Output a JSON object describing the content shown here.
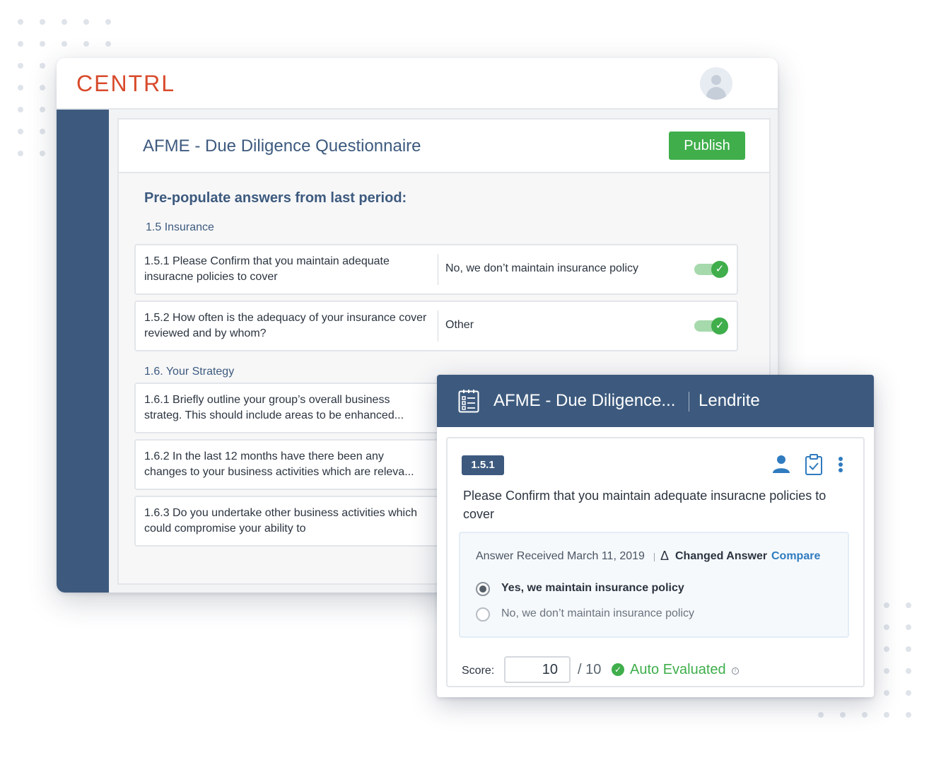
{
  "app": {
    "logo": "CENTRL"
  },
  "questionnaire": {
    "title": "AFME - Due Diligence Questionnaire",
    "publish_label": "Publish",
    "prepopulate_heading": "Pre-populate answers from last period:",
    "sections": [
      {
        "label": "1.5 Insurance",
        "questions": [
          {
            "text": "1.5.1 Please Confirm that you maintain adequate insuracne policies to cover",
            "answer": "No, we don’t maintain insurance policy",
            "toggle": "on"
          },
          {
            "text": "1.5.2 How often is the adequacy of your insurance cover reviewed and by whom?",
            "answer": "Other",
            "toggle": "on"
          }
        ]
      },
      {
        "label": "1.6. Your Strategy",
        "questions": [
          {
            "text": "1.6.1 Briefly outline your group’s overall business strateg. This should include areas to be enhanced..."
          },
          {
            "text": "1.6.2 In the last 12 months have there been any changes to your business activities which are releva..."
          },
          {
            "text": "1.6.3 Do you undertake other business activities which could compromise your ability to"
          }
        ]
      }
    ]
  },
  "card": {
    "title": "AFME - Due Diligence...",
    "company": "Lendrite",
    "question_number": "1.5.1",
    "question_text": "Please Confirm that you maintain adequate insuracne policies to cover",
    "received": "Answer Received March 11, 2019",
    "delta_symbol": "Δ",
    "changed_label": "Changed Answer",
    "compare_label": "Compare",
    "options": [
      {
        "label": "Yes, we maintain insurance policy",
        "selected": true
      },
      {
        "label": "No, we don’t maintain insurance policy",
        "selected": false
      }
    ],
    "score_label": "Score:",
    "score_value": "10",
    "score_max": "/ 10",
    "auto_label": "Auto Evaluated"
  },
  "colors": {
    "brand": "#d84a2b",
    "navy": "#3d5a7e",
    "green": "#3fae4b",
    "link": "#2f7bbf"
  },
  "icons": [
    "user-avatar-icon",
    "document-list-icon",
    "person-icon",
    "clipboard-check-icon",
    "more-vertical-icon",
    "check-icon",
    "info-icon"
  ]
}
